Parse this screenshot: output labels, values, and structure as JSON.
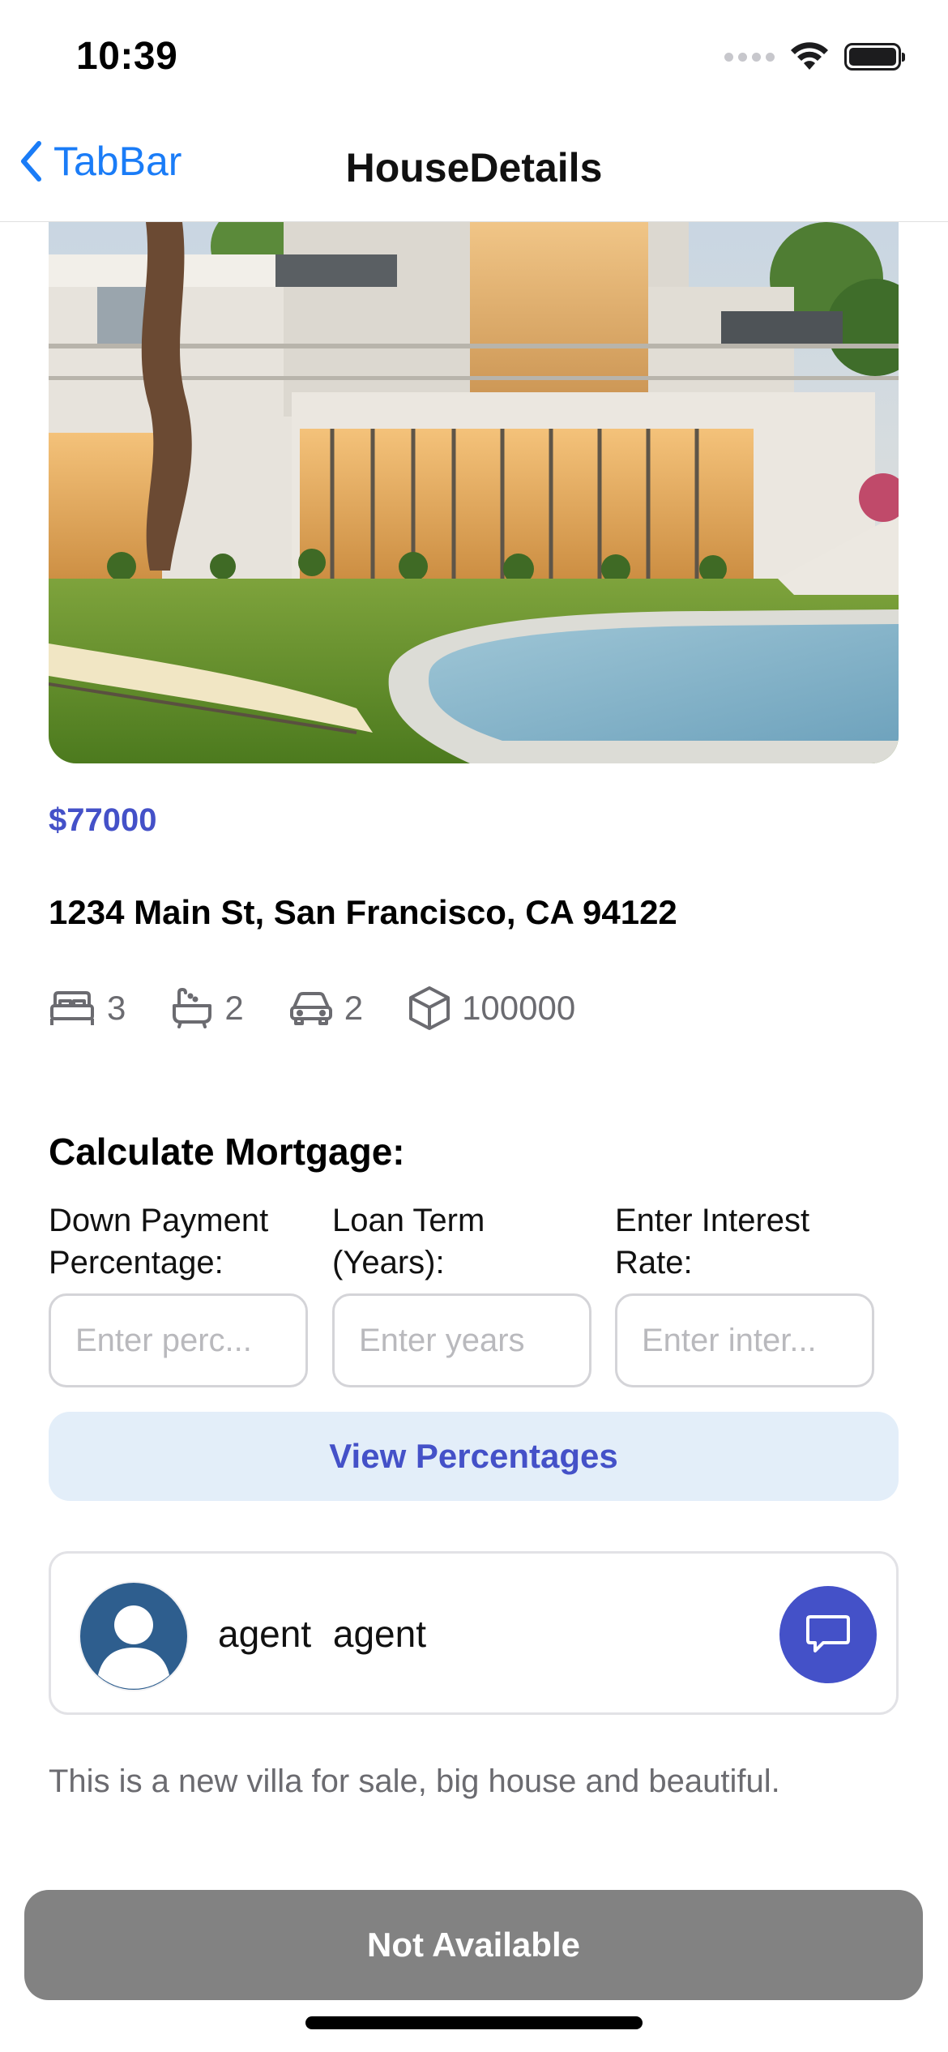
{
  "status_bar": {
    "time": "10:39"
  },
  "nav": {
    "back_label": "TabBar",
    "title": "HouseDetails"
  },
  "listing": {
    "price": "$77000",
    "address": "1234 Main St, San Francisco, CA 94122",
    "features": {
      "bedrooms": "3",
      "bathrooms": "2",
      "garage": "2",
      "area": "100000"
    },
    "description": "This is a new villa for sale, big house and beautiful."
  },
  "mortgage": {
    "title": "Calculate Mortgage:",
    "down_payment": {
      "label": "Down Payment Percentage:",
      "placeholder": "Enter perc...",
      "value": ""
    },
    "loan_term": {
      "label": "Loan Term (Years):",
      "placeholder": "Enter years",
      "value": ""
    },
    "interest": {
      "label": "Enter Interest Rate:",
      "placeholder": "Enter inter...",
      "value": ""
    },
    "view_button": "View Percentages"
  },
  "agent": {
    "name": "agent  agent"
  },
  "footer": {
    "status_button": "Not Available"
  },
  "colors": {
    "accent": "#4451c8",
    "link": "#1a7cf7",
    "button_light": "#e3eef9",
    "disabled": "#828282"
  }
}
